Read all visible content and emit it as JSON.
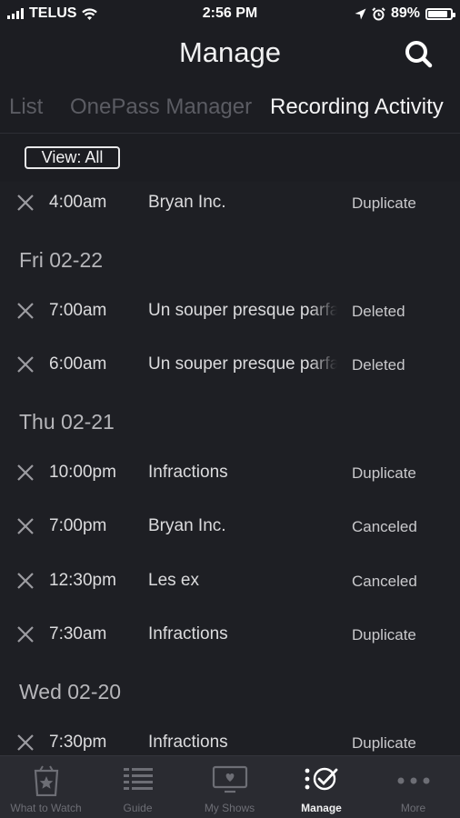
{
  "status_bar": {
    "carrier": "TELUS",
    "time": "2:56 PM",
    "battery": "89%",
    "battery_level": 0.89
  },
  "header": {
    "title": "Manage",
    "search_icon": "search-icon"
  },
  "tabs": [
    {
      "label": "List"
    },
    {
      "label": "OnePass Manager"
    },
    {
      "label": "Recording Activity",
      "active": true
    }
  ],
  "filter": {
    "label": "View:  All"
  },
  "activity": [
    {
      "type": "item",
      "time": "4:00am",
      "show": "Bryan Inc.",
      "status": "Duplicate"
    },
    {
      "type": "date",
      "label": "Fri 02-22"
    },
    {
      "type": "item",
      "time": "7:00am",
      "show": "Un souper presque parfait",
      "status": "Deleted"
    },
    {
      "type": "item",
      "time": "6:00am",
      "show": "Un souper presque parfait",
      "status": "Deleted"
    },
    {
      "type": "date",
      "label": "Thu 02-21"
    },
    {
      "type": "item",
      "time": "10:00pm",
      "show": "Infractions",
      "status": "Duplicate"
    },
    {
      "type": "item",
      "time": "7:00pm",
      "show": "Bryan Inc.",
      "status": "Canceled"
    },
    {
      "type": "item",
      "time": "12:30pm",
      "show": "Les ex",
      "status": "Canceled"
    },
    {
      "type": "item",
      "time": "7:30am",
      "show": "Infractions",
      "status": "Duplicate"
    },
    {
      "type": "date",
      "label": "Wed 02-20"
    },
    {
      "type": "item",
      "time": "7:30pm",
      "show": "Infractions",
      "status": "Duplicate"
    }
  ],
  "tab_bar": [
    {
      "label": "What to Watch",
      "icon": "star-box-icon"
    },
    {
      "label": "Guide",
      "icon": "guide-list-icon"
    },
    {
      "label": "My Shows",
      "icon": "tv-heart-icon"
    },
    {
      "label": "Manage",
      "icon": "manage-check-icon",
      "active": true
    },
    {
      "label": "More",
      "icon": "more-dots-icon"
    }
  ]
}
